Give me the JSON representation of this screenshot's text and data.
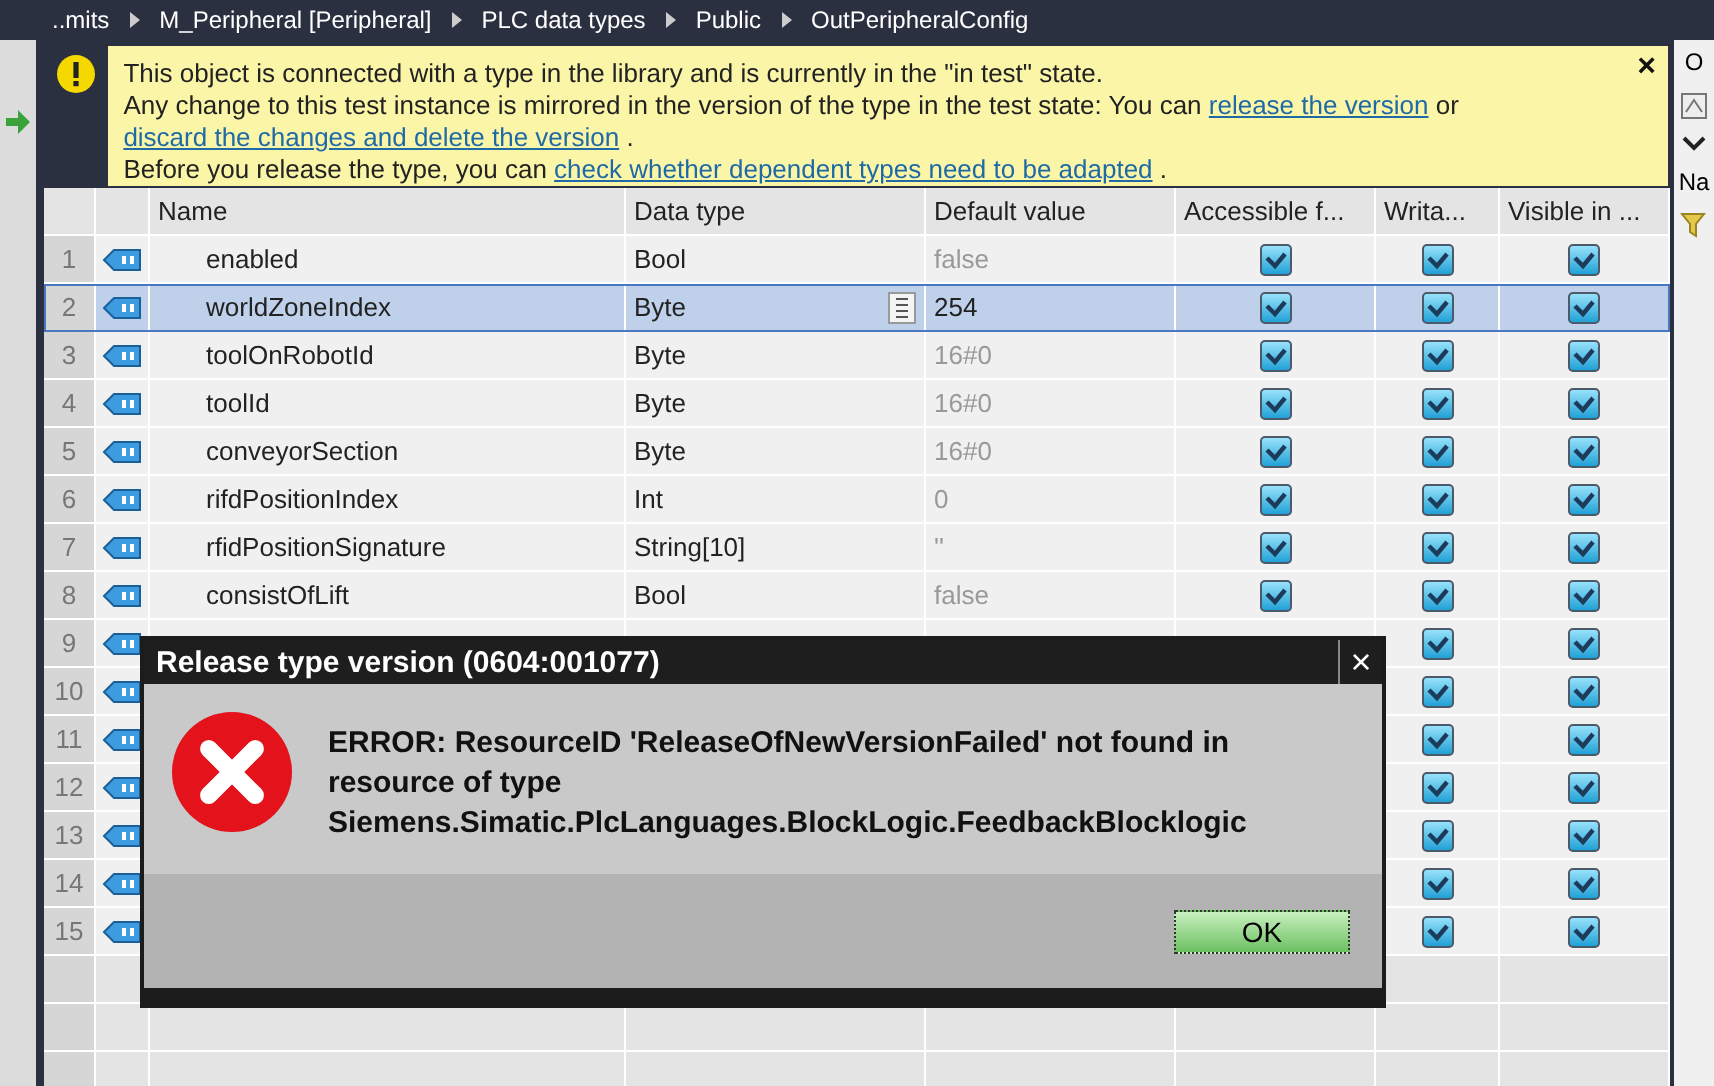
{
  "breadcrumb": [
    "..mits",
    "M_Peripheral [Peripheral]",
    "PLC data types",
    "Public",
    "OutPeripheralConfig"
  ],
  "banner": {
    "lines": [
      [
        {
          "kind": "text",
          "text": "This object is connected with a type in the library and is currently in the \"in test\" state."
        }
      ],
      [
        {
          "kind": "text",
          "text": "Any change to this test instance is mirrored in the version of the type in the test state: You can "
        },
        {
          "kind": "link",
          "text": "release the version"
        },
        {
          "kind": "text",
          "text": " or "
        },
        {
          "kind": "link",
          "text": "discard the changes and delete the version"
        },
        {
          "kind": "text",
          "text": " ."
        }
      ],
      [
        {
          "kind": "text",
          "text": "Before you release the type, you can "
        },
        {
          "kind": "link",
          "text": "check whether dependent types need to be adapted"
        },
        {
          "kind": "text",
          "text": " ."
        }
      ]
    ],
    "close": "×"
  },
  "table": {
    "columns": [
      "Name",
      "Data type",
      "Default value",
      "Accessible f...",
      "Writa...",
      "Visible in ..."
    ],
    "rows": [
      {
        "number": "1",
        "name": "enabled",
        "data_type": "Bool",
        "default_value": "false",
        "default_greyed": true,
        "accessible": true,
        "writable": true,
        "visible": true,
        "selected": false
      },
      {
        "number": "2",
        "name": "worldZoneIndex",
        "data_type": "Byte",
        "default_value": "254",
        "default_greyed": false,
        "accessible": true,
        "writable": true,
        "visible": true,
        "selected": true
      },
      {
        "number": "3",
        "name": "toolOnRobotId",
        "data_type": "Byte",
        "default_value": "16#0",
        "default_greyed": true,
        "accessible": true,
        "writable": true,
        "visible": true,
        "selected": false
      },
      {
        "number": "4",
        "name": "toolId",
        "data_type": "Byte",
        "default_value": "16#0",
        "default_greyed": true,
        "accessible": true,
        "writable": true,
        "visible": true,
        "selected": false
      },
      {
        "number": "5",
        "name": "conveyorSection",
        "data_type": "Byte",
        "default_value": "16#0",
        "default_greyed": true,
        "accessible": true,
        "writable": true,
        "visible": true,
        "selected": false
      },
      {
        "number": "6",
        "name": "rifdPositionIndex",
        "data_type": "Int",
        "default_value": "0",
        "default_greyed": true,
        "accessible": true,
        "writable": true,
        "visible": true,
        "selected": false
      },
      {
        "number": "7",
        "name": "rfidPositionSignature",
        "data_type": "String[10]",
        "default_value": "''",
        "default_greyed": true,
        "accessible": true,
        "writable": true,
        "visible": true,
        "selected": false
      },
      {
        "number": "8",
        "name": "consistOfLift",
        "data_type": "Bool",
        "default_value": "false",
        "default_greyed": true,
        "accessible": true,
        "writable": true,
        "visible": true,
        "selected": false
      },
      {
        "number": "9",
        "writable": true,
        "visible": true,
        "selected": false
      },
      {
        "number": "10",
        "writable": true,
        "visible": true,
        "selected": false
      },
      {
        "number": "11",
        "writable": true,
        "visible": true,
        "selected": false
      },
      {
        "number": "12",
        "writable": true,
        "visible": true,
        "selected": false
      },
      {
        "number": "13",
        "writable": true,
        "visible": true,
        "selected": false
      },
      {
        "number": "14",
        "writable": true,
        "visible": true,
        "selected": false
      },
      {
        "number": "15",
        "writable": true,
        "visible": true,
        "selected": false
      }
    ]
  },
  "dialog": {
    "title": "Release type version (0604:001077)",
    "close": "×",
    "message": "ERROR: ResourceID 'ReleaseOfNewVersionFailed' not found in resource of type Siemens.Simatic.PlcLanguages.BlockLogic.FeedbackBlocklogic",
    "button": "OK"
  },
  "side_panel": {
    "tab": "O",
    "header": "Na"
  }
}
